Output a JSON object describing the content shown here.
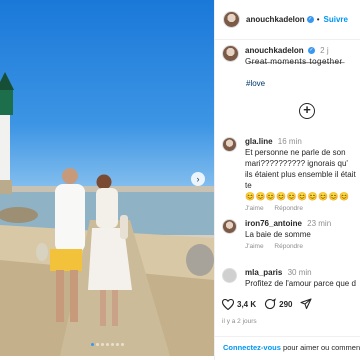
{
  "post": {
    "username": "anouchkadelon",
    "follow_label": "Suivre",
    "separator": "•",
    "verified_glyph": "✓"
  },
  "caption": {
    "username": "anouchkadelon",
    "time": "2 j",
    "text": "G̶r̶e̶a̶t̶ ̶m̶o̶m̶e̶n̶t̶s̶ ̶t̶o̶g̶e̶t̶h̶e̶r̶",
    "hashtag": "#love"
  },
  "comments": [
    {
      "username": "gla.line",
      "time": "16 min",
      "text": "Et personne ne parle de son mari?????????? ignorais qu' ils étaient plus ensemble il était te",
      "emoji": "😊😊😊😊😊😊😊😊😊😊",
      "like_label": "J'aime",
      "reply_label": "Répondre"
    },
    {
      "username": "iron76_antoine",
      "time": "23 min",
      "text": "La baie de somme",
      "like_label": "J'aime",
      "reply_label": "Répondre"
    },
    {
      "username": "mla_paris",
      "time": "30 min",
      "text": "Profitez de l'amour parce que d"
    }
  ],
  "actions": {
    "likes": "3,4 K",
    "comments": "290",
    "ago": "il y a 2 jours"
  },
  "footer": {
    "link": "Connectez-vous",
    "text": " pour aimer ou commen"
  },
  "icons": {
    "next": "chevron-right-icon",
    "add": "plus-circle-icon",
    "like": "heart-icon",
    "comment": "comment-bubble-icon",
    "share": "paper-plane-icon"
  },
  "colors": {
    "accent": "#0095f6",
    "hashtag": "#00376b",
    "muted": "#8e8e8e"
  },
  "carousel": {
    "slide_count": 7,
    "active_index": 0
  }
}
